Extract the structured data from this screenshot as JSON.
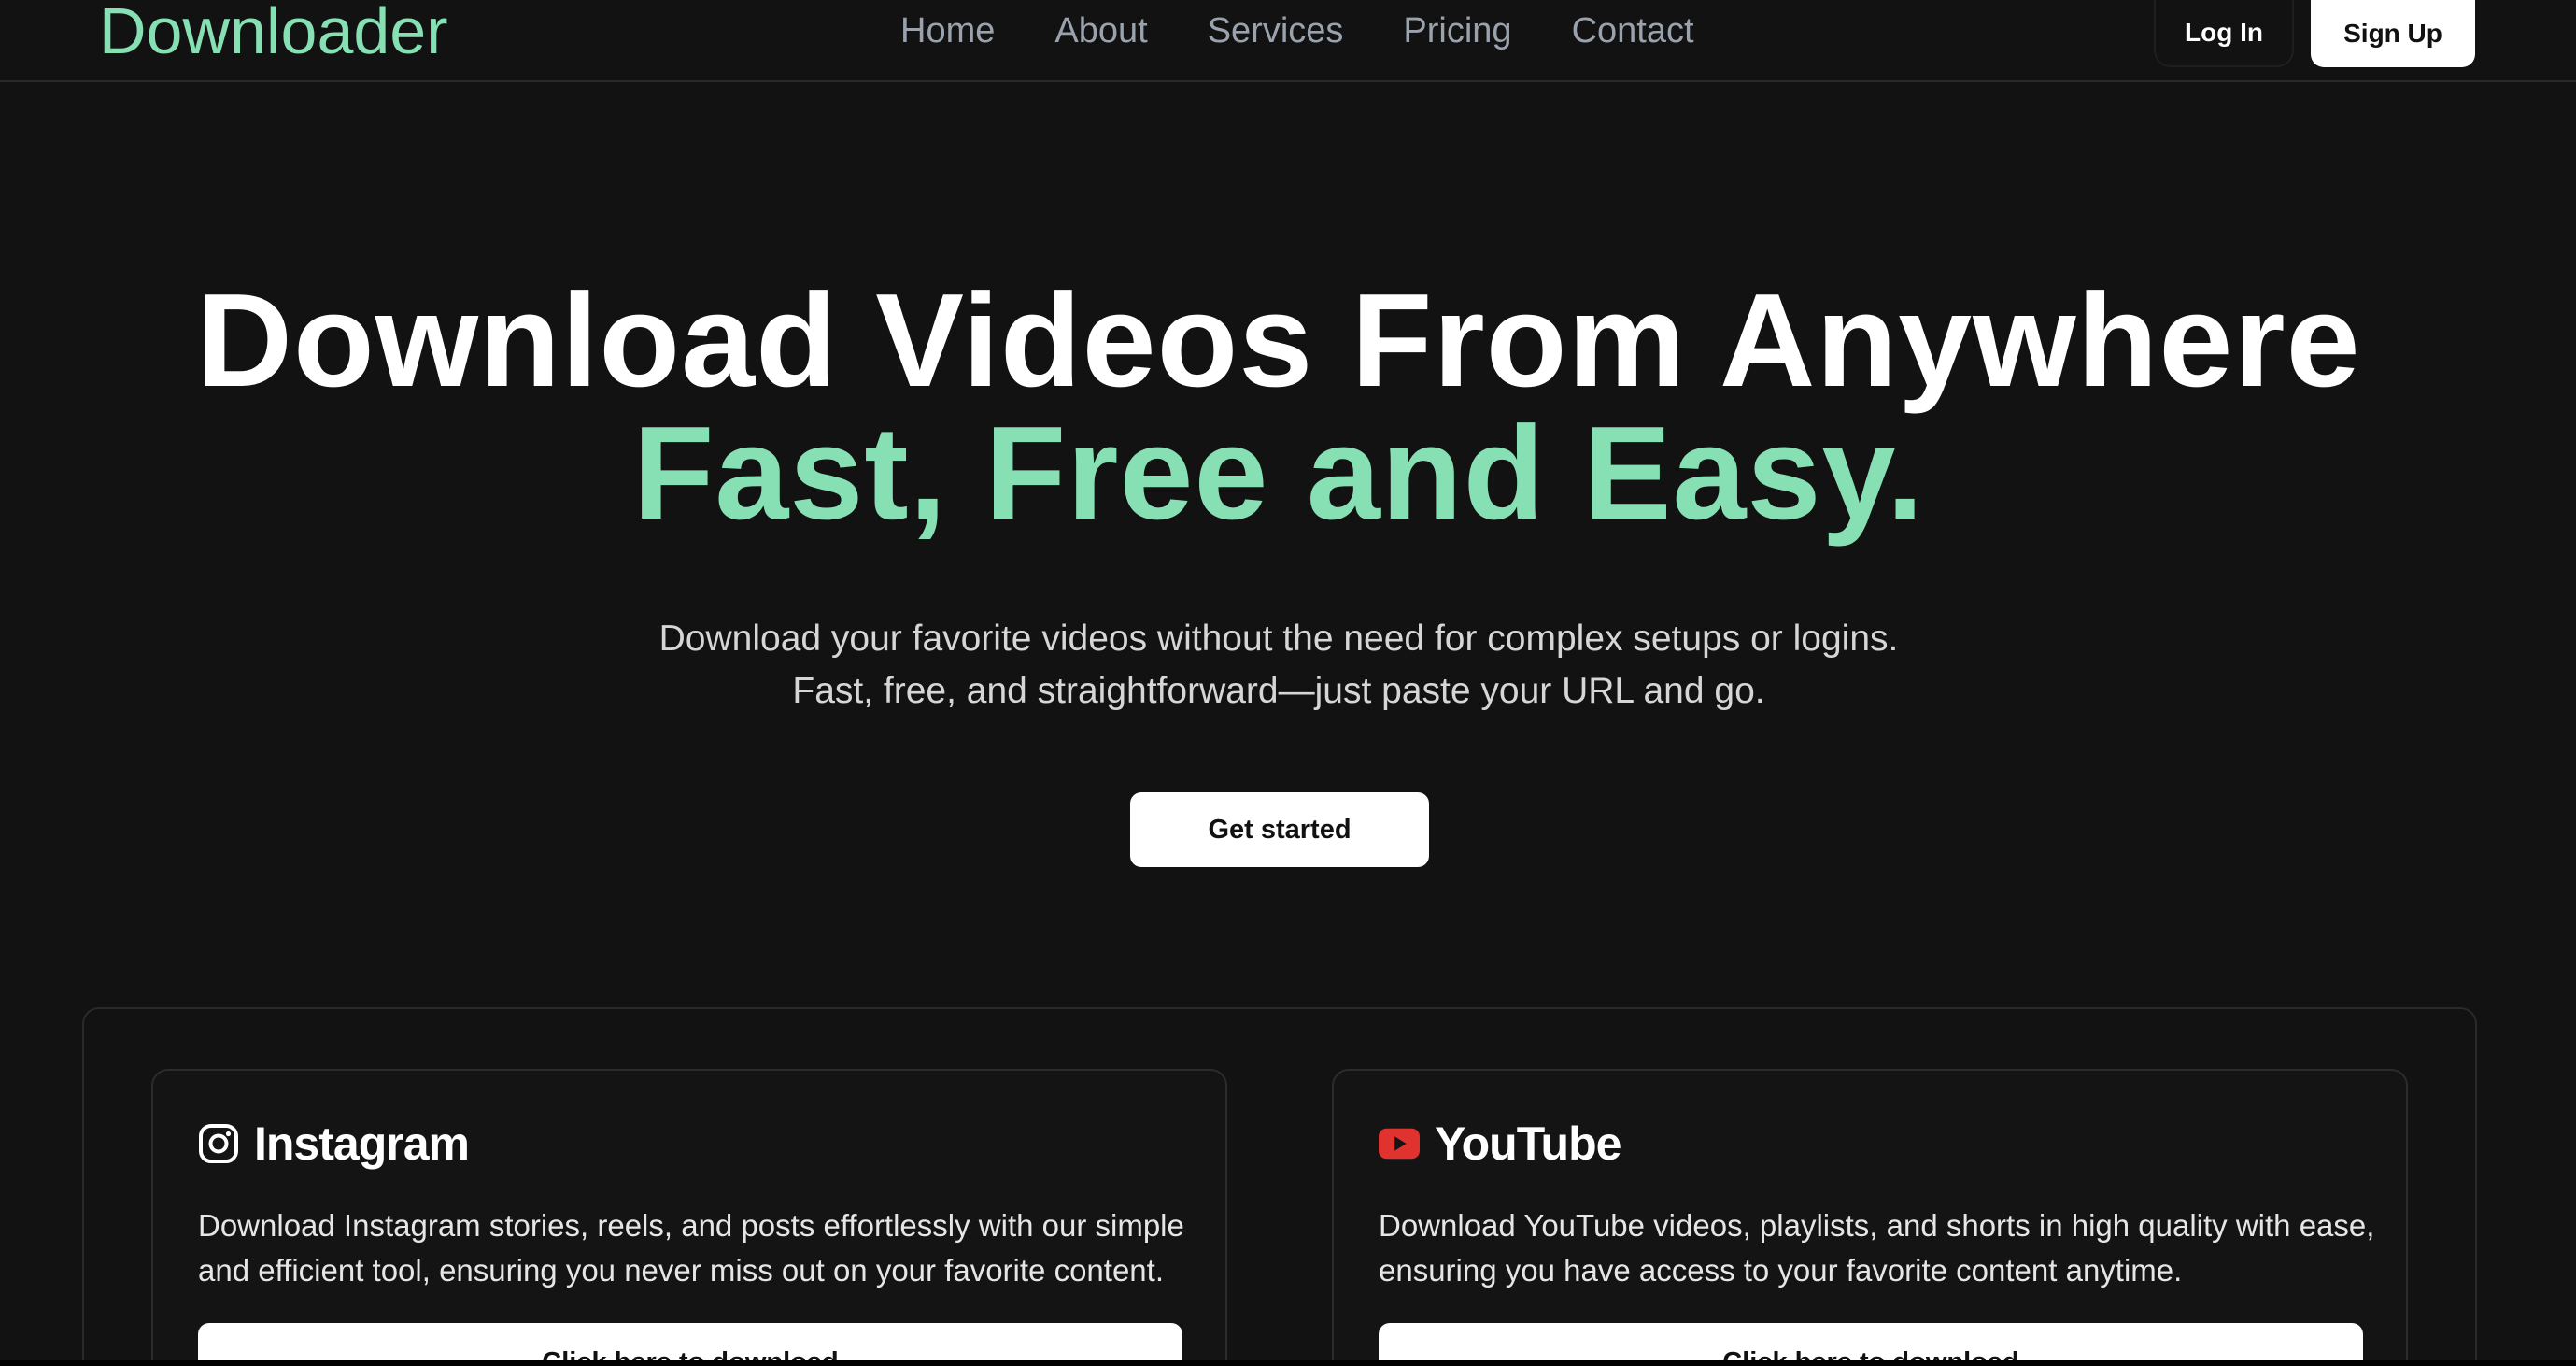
{
  "header": {
    "logo": "Downloader",
    "nav": [
      {
        "label": "Home"
      },
      {
        "label": "About"
      },
      {
        "label": "Services"
      },
      {
        "label": "Pricing"
      },
      {
        "label": "Contact"
      }
    ],
    "login_label": "Log In",
    "signup_label": "Sign Up"
  },
  "hero": {
    "title": "Download Videos From Anywhere",
    "accent": "Fast, Free and Easy.",
    "subtitle_line1": "Download your favorite videos without the need for complex setups or logins.",
    "subtitle_line2": "Fast, free, and straightforward—just paste your URL and go.",
    "cta_label": "Get started"
  },
  "services": [
    {
      "icon": "instagram-icon",
      "title": "Instagram",
      "description": "Download Instagram stories, reels, and posts effortlessly with our simple and efficient tool, ensuring you never miss out on your favorite content.",
      "button_label": "Click here to download"
    },
    {
      "icon": "youtube-icon",
      "title": "YouTube",
      "description": "Download YouTube videos, playlists, and shorts in high quality with ease, ensuring you have access to your favorite content anytime.",
      "button_label": "Click here to download"
    }
  ],
  "colors": {
    "background": "#121212",
    "accent": "#86e0b4",
    "youtube_red": "#e0322e"
  }
}
